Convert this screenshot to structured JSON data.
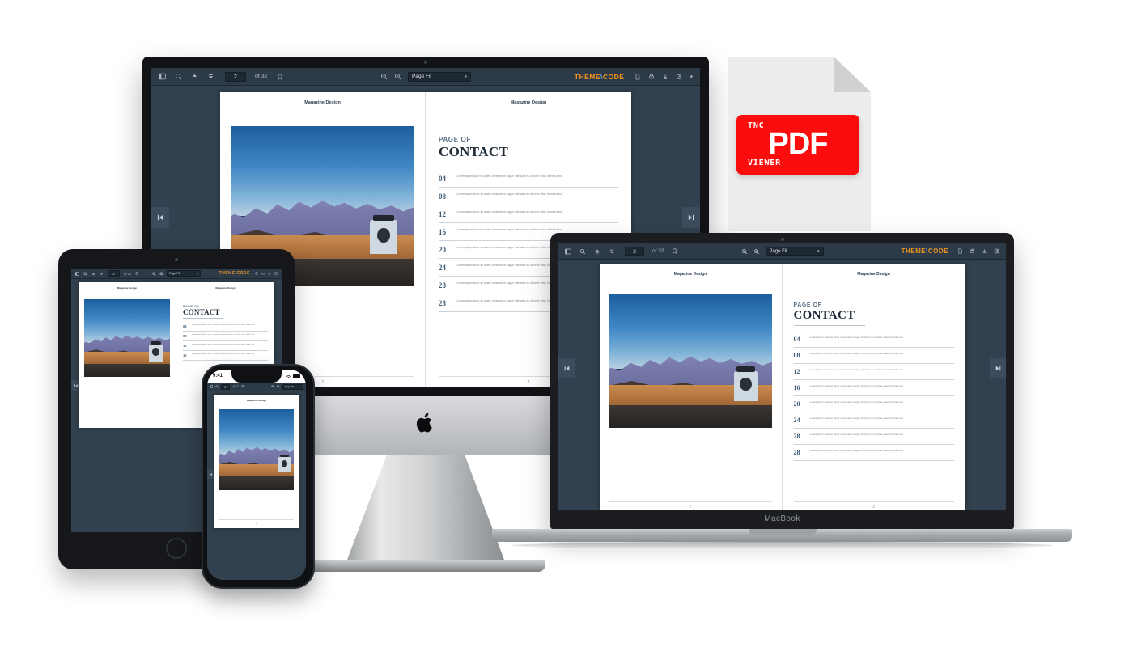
{
  "toolbar": {
    "sidebar_toggle_icon": "sidebar-toggle-icon",
    "search_icon": "search-icon",
    "page_up_icon": "page-up-icon",
    "page_down_icon": "page-down-icon",
    "page_number": "2",
    "of_total": "of 32",
    "bookmark_icon": "bookmark-icon",
    "zoom_out_icon": "zoom-out-icon",
    "zoom_in_icon": "zoom-in-icon",
    "scale_value": "Page Fit",
    "scale_caret_icon": "chevron-down-icon",
    "logo_theme": "THEME",
    "logo_chevron": "\\",
    "logo_code": "CODE",
    "doc_props_icon": "document-properties-icon",
    "print_icon": "print-icon",
    "download_icon": "download-icon",
    "open_new_icon": "open-in-new-icon",
    "more_icon": "more-options-icon"
  },
  "nav": {
    "prev_page_icon": "skip-previous-icon",
    "next_page_icon": "skip-next-icon"
  },
  "document": {
    "page_left": {
      "header": "Magazine Design",
      "footer_page": "2",
      "photo_alt": "desert-landscape-with-offroad-vehicle"
    },
    "page_right": {
      "header": "Magazine Design",
      "footer_page": "3",
      "kicker": "PAGE OF",
      "title": "CONTACT",
      "entries": [
        {
          "num": "04",
          "text": "Lorem ipsum dolor sit amet, consectetur augue interdum eu ultricies vitae, blandit a est."
        },
        {
          "num": "08",
          "text": "Lorem ipsum dolor sit amet, consectetur augue interdum eu ultricies vitae, blandit a est."
        },
        {
          "num": "12",
          "text": "Lorem ipsum dolor sit amet, consectetur augue interdum eu ultricies vitae, blandit a est."
        },
        {
          "num": "16",
          "text": "Lorem ipsum dolor sit amet, consectetur augue interdum eu ultricies vitae, blandit a est."
        },
        {
          "num": "20",
          "text": "Lorem ipsum dolor sit amet, consectetur augue interdum eu ultricies vitae, blandit a est."
        },
        {
          "num": "24",
          "text": "Lorem ipsum dolor sit amet, consectetur augue interdum eu ultricies vitae, blandit a est."
        },
        {
          "num": "28",
          "text": "Lorem ipsum dolor sit amet, consectetur augue interdum eu ultricies vitae, blandit a est."
        },
        {
          "num": "28",
          "text": "Lorem ipsum dolor sit amet, consectetur augue interdum eu ultricies vitae, blandit a est."
        }
      ]
    }
  },
  "devices": {
    "imac": {
      "name": "iMac",
      "apple_logo_icon": "apple-logo-icon"
    },
    "macbook": {
      "name": "MacBook",
      "label": "MacBook"
    },
    "ipad": {
      "name": "iPad",
      "home_button_icon": "home-button-icon"
    },
    "iphone": {
      "name": "iPhone",
      "status_time": "9:41",
      "wifi_icon": "wifi-icon",
      "battery_icon": "battery-icon"
    }
  },
  "file_icon": {
    "top_text": "TNC",
    "main_text": "PDF",
    "bottom_text": "VIEWER",
    "badge_color": "#fb0d0d",
    "sheet_color": "#eceded"
  },
  "colors": {
    "viewer_bg": "#32414f",
    "toolbar_bg": "#2d3b49",
    "accent_orange": "#f0941f",
    "accent_blue": "#6fa8dc",
    "page_white": "#ffffff"
  }
}
